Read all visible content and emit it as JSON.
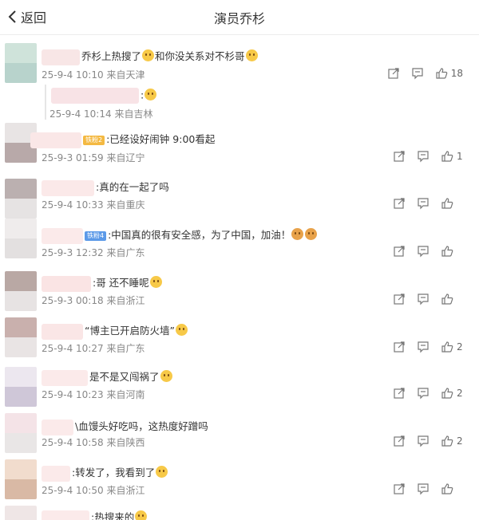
{
  "header": {
    "back_label": "返回",
    "title": "演员乔杉"
  },
  "comments": [
    {
      "text": "乔杉上热搜了",
      "text2": "和你没关系对不杉哥",
      "time": "25-9-4 10:10",
      "location": "来自天津",
      "likes": "18"
    },
    {
      "reply_text": ":",
      "time": "25-9-4 10:14",
      "location": "来自吉林"
    },
    {
      "badge": "铁粉2",
      "text": ":已经设好闹钟 9:00看起",
      "time": "25-9-3 01:59",
      "location": "来自辽宁",
      "likes": "1"
    },
    {
      "text": ":真的在一起了吗",
      "time": "25-9-4 10:33",
      "location": "来自重庆",
      "likes": ""
    },
    {
      "badge": "铁粉4",
      "text": ":中国真的很有安全感，为了中国，加油！",
      "time": "25-9-3 12:32",
      "location": "来自广东",
      "likes": ""
    },
    {
      "text": ":哥 还不睡呢",
      "time": "25-9-3 00:18",
      "location": "来自浙江",
      "likes": ""
    },
    {
      "text": "“博主已开启防火墙”",
      "time": "25-9-4 10:27",
      "location": "来自广东",
      "likes": "2"
    },
    {
      "text": "是不是又闯祸了",
      "time": "25-9-4 10:23",
      "location": "来自河南",
      "likes": "2"
    },
    {
      "text": "\\血馒头好吃吗，这热度好蹭吗",
      "time": "25-9-4 10:58",
      "location": "来自陕西",
      "likes": "2"
    },
    {
      "text": ":转发了，我看到了",
      "time": "25-9-4 10:50",
      "location": "来自浙江",
      "likes": ""
    },
    {
      "text": ":热搜来的",
      "time": "",
      "location": "",
      "likes": ""
    }
  ],
  "colors": {
    "blur_a": "#d9e6e2",
    "blur_b": "#f6dcdc",
    "avatar_1": "#c8ddd6",
    "avatar_2": "#b9a7a7"
  },
  "icons": [
    "chevron-left-icon",
    "share-icon",
    "comment-icon",
    "like-icon"
  ]
}
